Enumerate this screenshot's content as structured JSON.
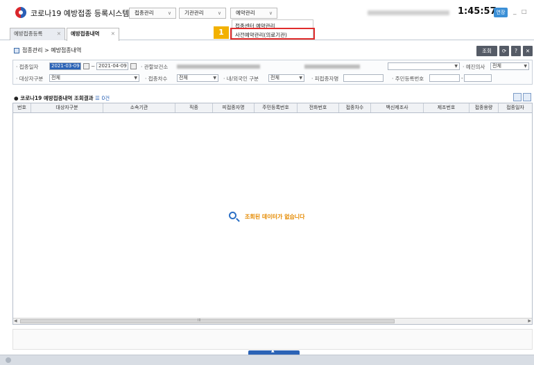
{
  "header": {
    "app_title": "코로나19 예방접종 등록시스템",
    "menus": [
      {
        "label": "접종관리"
      },
      {
        "label": "기관관리"
      },
      {
        "label": "예약관리"
      }
    ],
    "clock": "1:45:57",
    "extend_button": "연장",
    "window_min": "_",
    "window_max": "□"
  },
  "dropdown": {
    "items": [
      "접종센터 예약관리",
      "사전예약관리(의료기관)"
    ],
    "highlighted_index": 1,
    "step_badge": "1"
  },
  "tabs": [
    {
      "label": "예방접종등록",
      "close": "✕"
    },
    {
      "label": "예방접종내역",
      "close": "✕",
      "active": true
    }
  ],
  "breadcrumb": "접종관리 > 예방접종내역",
  "toolbar": {
    "search": "조회",
    "help": "?",
    "close": "✕"
  },
  "filters": {
    "row1": {
      "date_label": "· 접종일자",
      "date_from": "2021-03-09",
      "date_to": "2021-04-09",
      "health_center_label": "· 관할보건소",
      "doctor_label": "· 예진의사",
      "doctor_value": "전체"
    },
    "row2": {
      "target_label": "· 대상자구분",
      "target_value": "전체",
      "dose_label": "· 접종차수",
      "dose_value": "전체",
      "nationality_label": "· 내/외국인 구분",
      "nationality_value": "전체",
      "name_label": "· 피접종자명",
      "rrn_label": "· 주민등록번호",
      "rrn_sep": "-"
    }
  },
  "results": {
    "title": "코로나19 예방접종내역 조회결과",
    "count": "0건",
    "columns": [
      "번호",
      "대상자구분",
      "소속기관",
      "직종",
      "피접종자명",
      "주민등록번호",
      "전화번호",
      "접종차수",
      "백신제조사",
      "제조번호",
      "접종용량",
      "접종일자"
    ],
    "empty_message": "조회된 데이터가 없습니다"
  },
  "scrollbar": {
    "left_arrow": "◀",
    "right_arrow": "▶",
    "thumb_grip": "III"
  },
  "footer": {
    "handle": "▲"
  }
}
